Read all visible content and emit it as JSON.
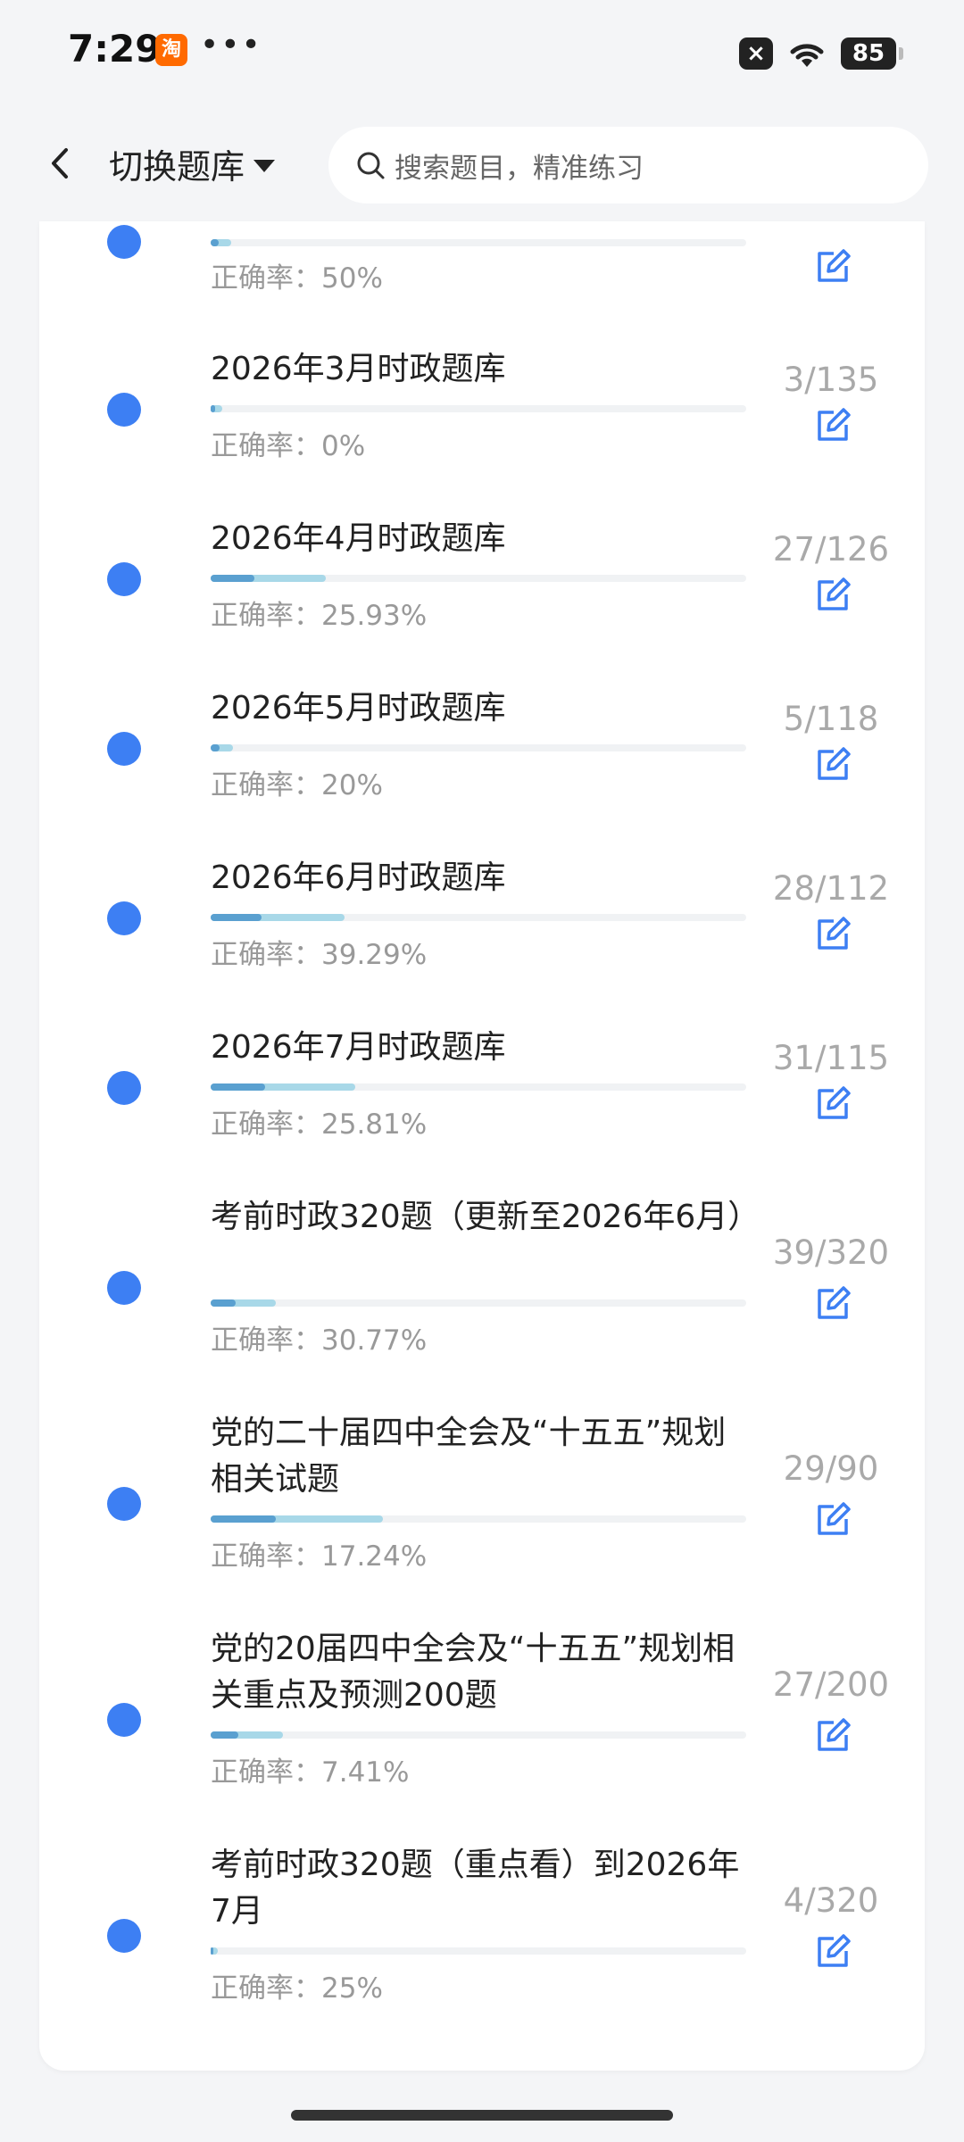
{
  "status_bar": {
    "time": "7:29",
    "app_icon": "淘",
    "dots": "•••",
    "x_badge": "×",
    "battery": "85"
  },
  "header": {
    "switch_label": "切换题库",
    "search_placeholder": "搜索题目，精准练习"
  },
  "accuracy_label": "正确率：",
  "colors": {
    "accent": "#3d7ff3",
    "bar_light": "#a8d8e8",
    "bar_dark": "#5aa0d0"
  },
  "items": [
    {
      "title": "",
      "accuracy": "50%",
      "count": "",
      "progress": 0.0377
    },
    {
      "title": "2026年3月时政题库",
      "accuracy": "0%",
      "count": "3/135",
      "progress": 0.0222
    },
    {
      "title": "2026年4月时政题库",
      "accuracy": "25.93%",
      "count": "27/126",
      "progress": 0.2143
    },
    {
      "title": "2026年5月时政题库",
      "accuracy": "20%",
      "count": "5/118",
      "progress": 0.0424
    },
    {
      "title": "2026年6月时政题库",
      "accuracy": "39.29%",
      "count": "28/112",
      "progress": 0.25
    },
    {
      "title": "2026年7月时政题库",
      "accuracy": "25.81%",
      "count": "31/115",
      "progress": 0.2696
    },
    {
      "title": "考前时政320题（更新至2026年6月）",
      "accuracy": "30.77%",
      "count": "39/320",
      "progress": 0.1219
    },
    {
      "title": "党的二十届四中全会及“十五五”规划相关试题",
      "accuracy": "17.24%",
      "count": "29/90",
      "progress": 0.3222
    },
    {
      "title": "党的20届四中全会及“十五五”规划相关重点及预测200题",
      "accuracy": "7.41%",
      "count": "27/200",
      "progress": 0.135
    },
    {
      "title": "考前时政320题（重点看）到2026年7月",
      "accuracy": "25%",
      "count": "4/320",
      "progress": 0.0125
    }
  ]
}
